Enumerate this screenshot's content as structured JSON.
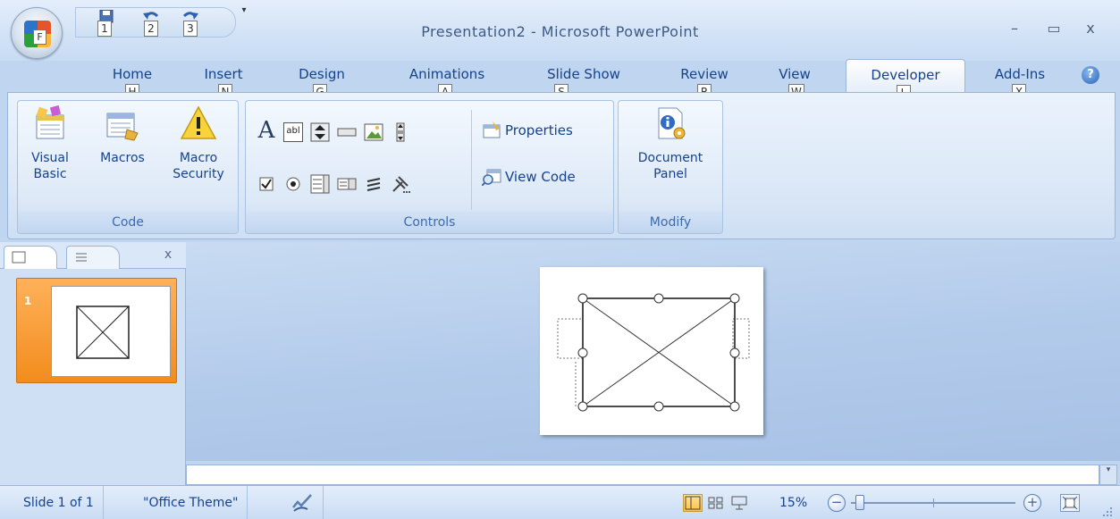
{
  "window": {
    "title": "Presentation2 - Microsoft PowerPoint",
    "office_button_keytip": "F",
    "minimize_glyph": "–",
    "maximize_glyph": "▭",
    "close_glyph": "x",
    "help_glyph": "?"
  },
  "quick_access": {
    "items": [
      {
        "name": "save-icon",
        "keytip": "1"
      },
      {
        "name": "undo-icon",
        "keytip": "2"
      },
      {
        "name": "redo-icon",
        "keytip": "3"
      }
    ],
    "more_glyph": "▾"
  },
  "tabs": [
    {
      "label": "Home",
      "keytip": "H"
    },
    {
      "label": "Insert",
      "keytip": "N"
    },
    {
      "label": "Design",
      "keytip": "G"
    },
    {
      "label": "Animations",
      "keytip": "A"
    },
    {
      "label": "Slide Show",
      "keytip": "S"
    },
    {
      "label": "Review",
      "keytip": "R"
    },
    {
      "label": "View",
      "keytip": "W"
    },
    {
      "label": "Developer",
      "keytip": "L",
      "active": true
    },
    {
      "label": "Add-Ins",
      "keytip": "X"
    }
  ],
  "ribbon": {
    "code": {
      "label": "Code",
      "visual_basic": "Visual\nBasic",
      "visual_basic_l1": "Visual",
      "visual_basic_l2": "Basic",
      "macros": "Macros",
      "macro_security_l1": "Macro",
      "macro_security_l2": "Security"
    },
    "controls": {
      "label": "Controls",
      "properties": "Properties",
      "view_code": "View Code",
      "label_glyph": "A",
      "textbox_glyph": "abl"
    },
    "modify": {
      "label": "Modify",
      "document_panel_l1": "Document",
      "document_panel_l2": "Panel"
    }
  },
  "slide_pane": {
    "close_glyph": "x",
    "slide_number": "1"
  },
  "status_bar": {
    "slide_info": "Slide 1 of 1",
    "theme": "\"Office Theme\"",
    "zoom_percent": "15%",
    "zoom_level": 0.15,
    "zoom_out_glyph": "−",
    "zoom_in_glyph": "+"
  },
  "colors": {
    "accent": "#15428b",
    "active_thumb": "#f28c1d",
    "ribbon_bg": "#dde9f8"
  }
}
